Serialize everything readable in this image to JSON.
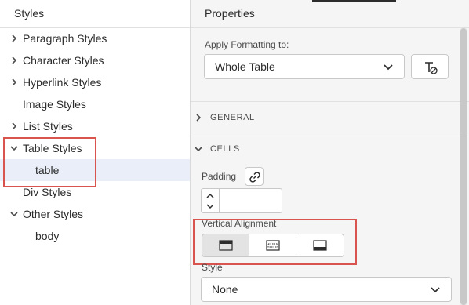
{
  "styles_panel": {
    "title": "Styles",
    "items": [
      {
        "label": "Paragraph Styles",
        "chevron": "right"
      },
      {
        "label": "Character Styles",
        "chevron": "right"
      },
      {
        "label": "Hyperlink Styles",
        "chevron": "right"
      },
      {
        "label": "Image Styles",
        "chevron": ""
      },
      {
        "label": "List Styles",
        "chevron": "right"
      },
      {
        "label": "Table Styles",
        "chevron": "down"
      },
      {
        "label": "table",
        "chevron": "",
        "selected": true
      },
      {
        "label": "Div Styles",
        "chevron": ""
      },
      {
        "label": "Other Styles",
        "chevron": "down"
      },
      {
        "label": "body",
        "chevron": ""
      }
    ]
  },
  "properties_panel": {
    "title": "Properties",
    "apply_label": "Apply Formatting to:",
    "apply_value": "Whole Table",
    "clear_format_icon": "clear-formatting-icon",
    "sections": {
      "general": "GENERAL",
      "cells": "CELLS"
    },
    "padding_label": "Padding",
    "padding_value": "",
    "link_icon": "link-icon",
    "vertical_alignment_label": "Vertical Alignment",
    "vertical_alignment_options": [
      "top",
      "middle",
      "bottom"
    ],
    "vertical_alignment_selected": "top",
    "style_label": "Style",
    "style_value": "None"
  },
  "colors": {
    "highlight_box": "#d9534f",
    "selected_row": "#e9eef9"
  }
}
